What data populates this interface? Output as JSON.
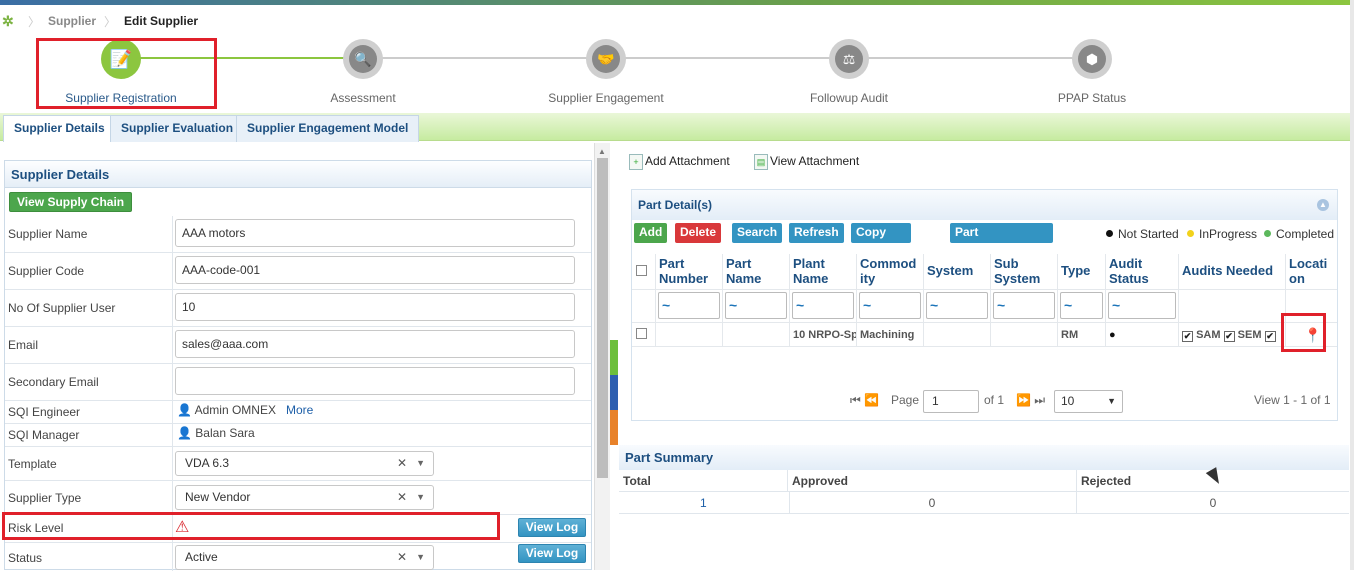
{
  "breadcrumb": {
    "items": [
      "Supplier",
      "Edit Supplier"
    ]
  },
  "wizard": {
    "steps": [
      {
        "label": "Supplier Registration",
        "icon": "registration-icon",
        "active": true
      },
      {
        "label": "Assessment",
        "icon": "assessment-icon",
        "active": false
      },
      {
        "label": "Supplier Engagement",
        "icon": "handshake-icon",
        "active": false
      },
      {
        "label": "Followup Audit",
        "icon": "audit-icon",
        "active": false
      },
      {
        "label": "PPAP Status",
        "icon": "cube-icon",
        "active": false
      }
    ]
  },
  "tabs": [
    {
      "label": "Supplier Details",
      "selected": true
    },
    {
      "label": "Supplier Evaluation",
      "selected": false
    },
    {
      "label": "Supplier Engagement Model",
      "selected": false
    }
  ],
  "supplier_details": {
    "title": "Supplier Details",
    "view_supply_chain": "View Supply Chain",
    "fields": {
      "supplier_name": {
        "label": "Supplier Name",
        "value": "AAA motors"
      },
      "supplier_code": {
        "label": "Supplier Code",
        "value": "AAA-code-001"
      },
      "no_users": {
        "label": "No Of Supplier User",
        "value": "10"
      },
      "email": {
        "label": "Email",
        "value": "sales@aaa.com"
      },
      "secondary_email": {
        "label": "Secondary Email",
        "value": ""
      },
      "sqi_engineer": {
        "label": "SQI Engineer",
        "value": "Admin OMNEX",
        "more": "More"
      },
      "sqi_manager": {
        "label": "SQI Manager",
        "value": "Balan Sara"
      },
      "template": {
        "label": "Template",
        "value": "VDA 6.3"
      },
      "supplier_type": {
        "label": "Supplier Type",
        "value": "New Vendor"
      },
      "risk_level": {
        "label": "Risk Level",
        "icon": "warning-icon"
      },
      "status": {
        "label": "Status",
        "value": "Active"
      }
    },
    "view_log": "View Log",
    "clear_symbol": "✕",
    "dropdown_symbol": "▼"
  },
  "toolbar": {
    "add_attachment": "Add Attachment",
    "view_attachment": "View Attachment"
  },
  "part_details": {
    "title": "Part Detail(s)",
    "buttons": [
      "Add",
      "Delete",
      "Search",
      "Refresh",
      "Copy Location",
      "Part Synchronization"
    ],
    "legend": [
      {
        "label": "Not Started",
        "color": "#111111"
      },
      {
        "label": "InProgress",
        "color": "#f2d21b"
      },
      {
        "label": "Completed",
        "color": "#5cb85c"
      }
    ],
    "columns": [
      "Part Number",
      "Part Name",
      "Plant Name",
      "Commodity",
      "System",
      "Sub System",
      "Type",
      "Audit Status",
      "Audits Needed",
      "Location"
    ],
    "column_display": [
      [
        "Part",
        "Number"
      ],
      [
        "Part",
        "Name"
      ],
      [
        "Plant",
        "Name"
      ],
      [
        "Commod",
        "ity"
      ],
      [
        "System"
      ],
      [
        "Sub",
        "System"
      ],
      [
        "Type"
      ],
      [
        "Audit",
        "Status"
      ],
      [
        "Audits Needed"
      ],
      [
        "Locati",
        "on"
      ]
    ],
    "filter_symbol": "~",
    "rows": [
      {
        "part_number": "",
        "part_name": "",
        "plant_name": "10 NRPO-Sp",
        "commodity": "Machining",
        "system": "",
        "sub_system": "",
        "type": "RM",
        "audit_status": "●",
        "audits_needed": [
          "SAM",
          "SEM"
        ],
        "location_icon": "map-pin-icon"
      }
    ],
    "pager": {
      "page_label": "Page",
      "page": "1",
      "of_label": "of 1",
      "page_size": "10",
      "view": "View 1 - 1 of 1"
    }
  },
  "part_summary": {
    "title": "Part Summary",
    "columns": [
      "Total",
      "Approved",
      "Rejected"
    ],
    "values": [
      "1",
      "0",
      "0"
    ]
  }
}
